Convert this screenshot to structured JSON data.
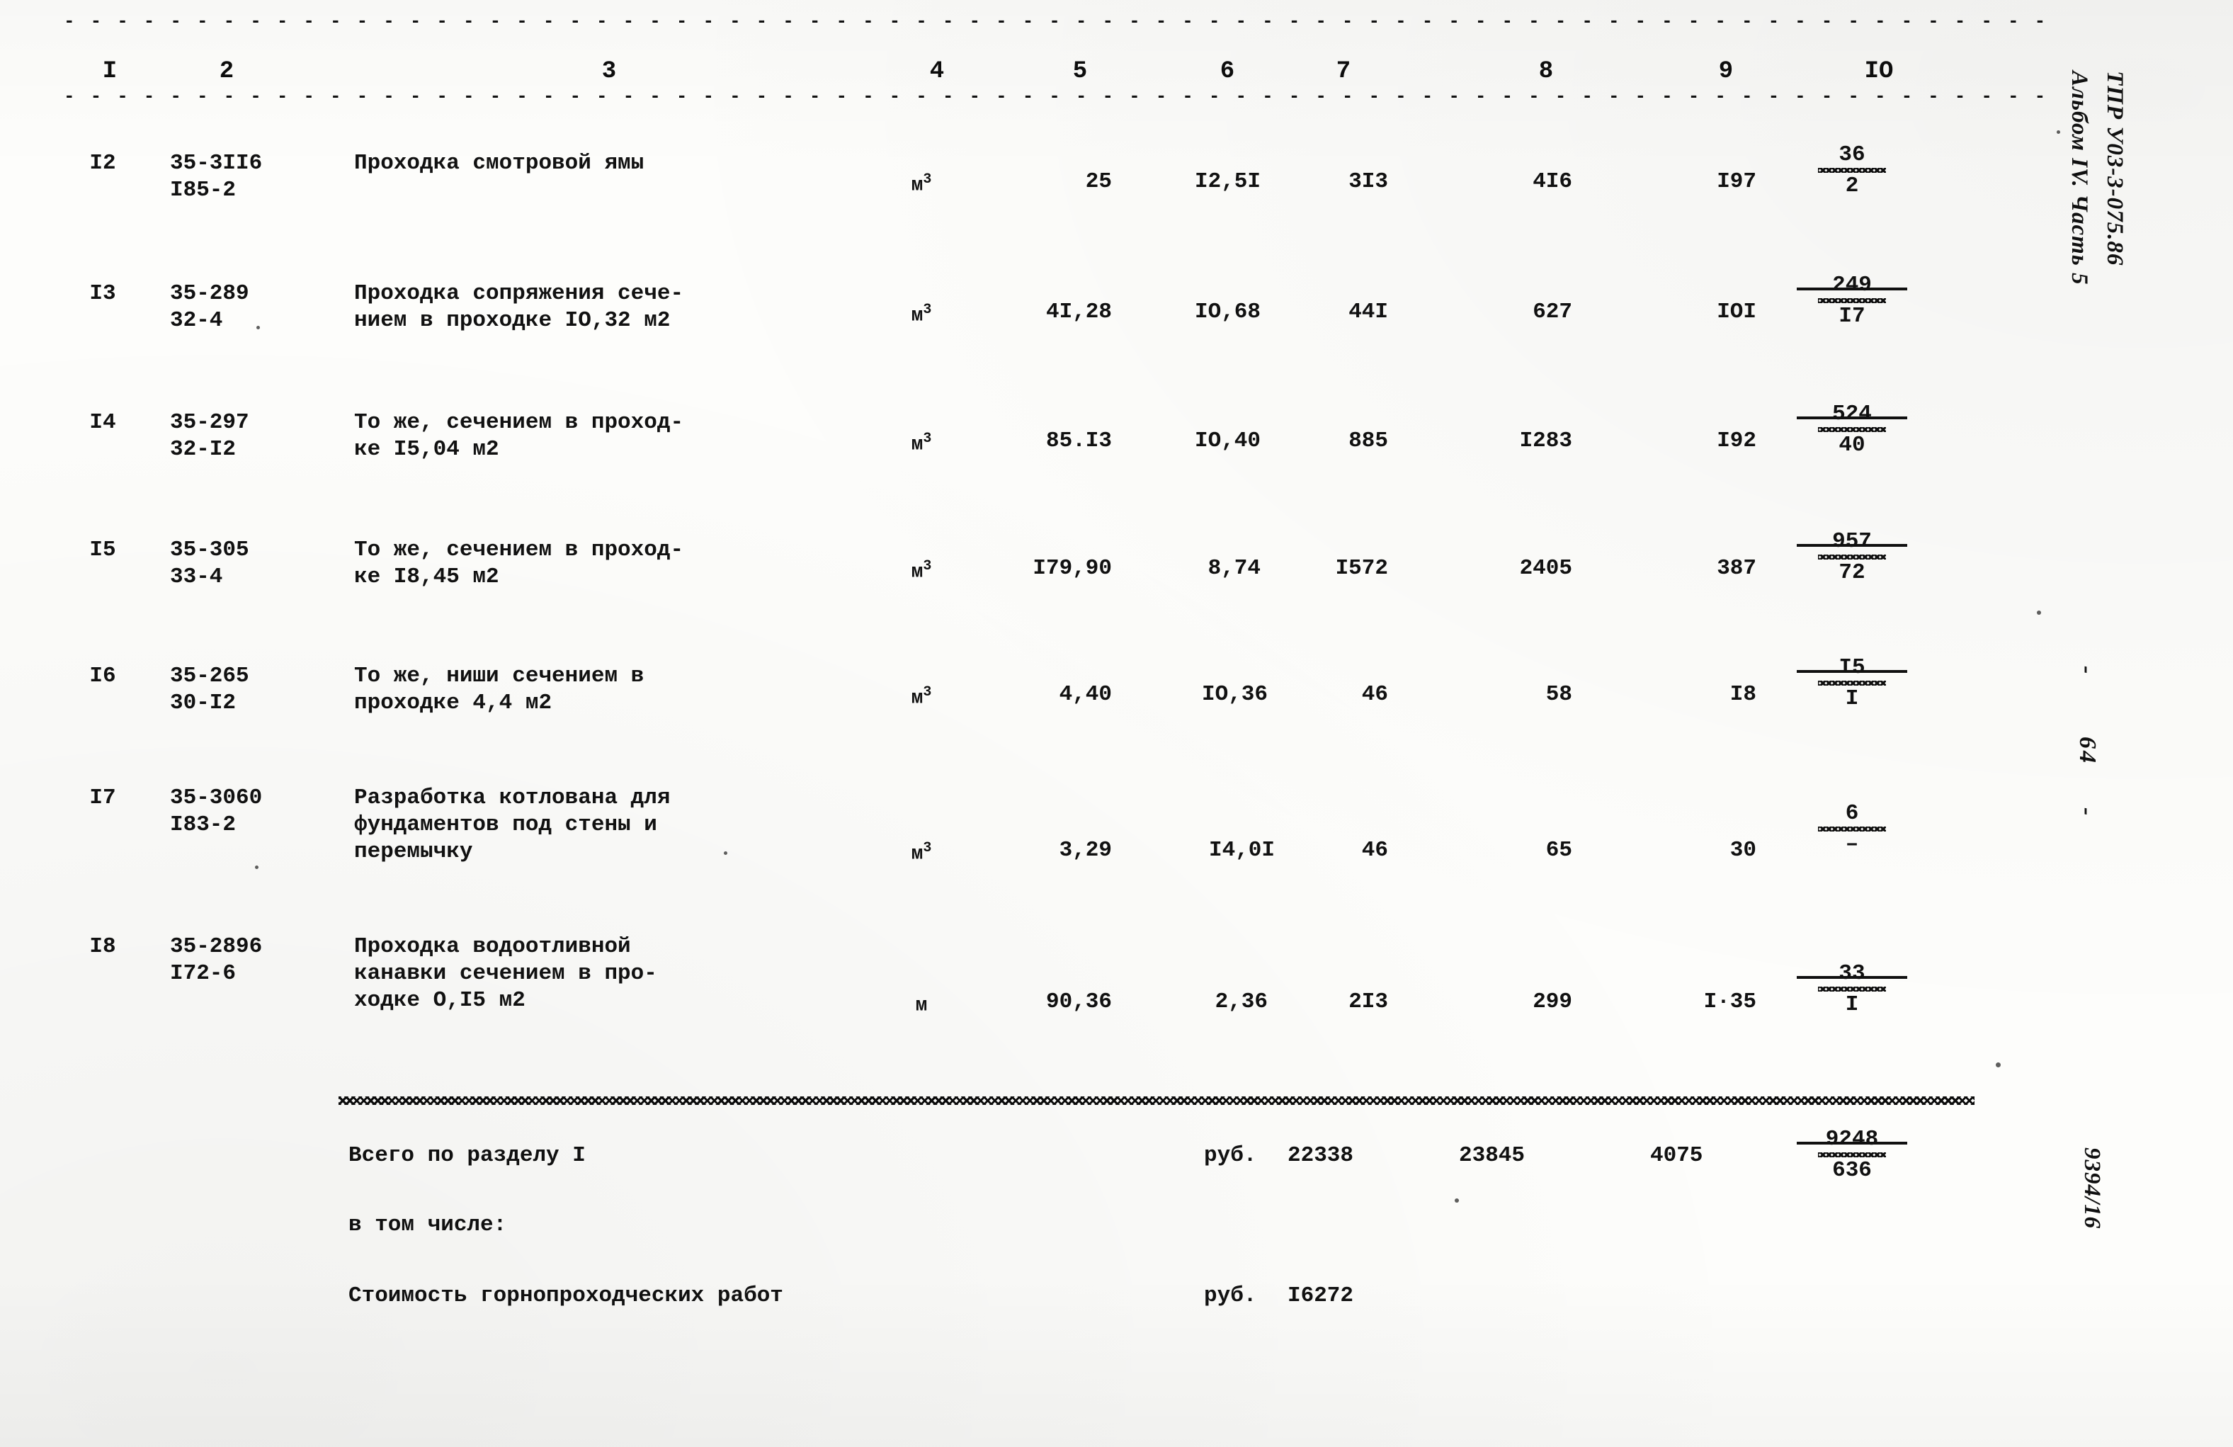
{
  "document": {
    "kind": "scanned-estimate-table",
    "language": "ru"
  },
  "table": {
    "column_headers": [
      "I",
      "2",
      "3",
      "4",
      "5",
      "6",
      "7",
      "8",
      "9",
      "IO"
    ],
    "rows": [
      {
        "no": "I2",
        "code_line1": "35-3II6",
        "code_line2": "I85-2",
        "description": "Проходка смотровой ямы",
        "unit": "м",
        "unit_sup": "3",
        "c5": "25",
        "c6": "I2,5I",
        "c7": "3I3",
        "c8": "4I6",
        "c9": "I97",
        "c10_top": "36",
        "c10_bottom": "2"
      },
      {
        "no": "I3",
        "code_line1": "35-289",
        "code_line2": "32-4",
        "description": "Проходка сопряжения сече-\nнием в проходке IO,32 м2",
        "unit": "м",
        "unit_sup": "3",
        "c5": "4I,28",
        "c6": "IO,68",
        "c7": "44I",
        "c8": "627",
        "c9": "IOI",
        "c10_top": "249",
        "c10_bottom": "I7"
      },
      {
        "no": "I4",
        "code_line1": "35-297",
        "code_line2": "32-I2",
        "description": "То же, сечением в проход-\nке I5,04 м2",
        "unit": "м",
        "unit_sup": "3",
        "c5": "85.I3",
        "c6": "IO,40",
        "c7": "885",
        "c8": "I283",
        "c9": "I92",
        "c10_top": "524",
        "c10_bottom": "40"
      },
      {
        "no": "I5",
        "code_line1": "35-305",
        "code_line2": "33-4",
        "description": "То же, сечением в проход-\nке I8,45 м2",
        "unit": "м",
        "unit_sup": "3",
        "c5": "I79,90",
        "c6": "8,74",
        "c7": "I572",
        "c8": "2405",
        "c9": "387",
        "c10_top": "957",
        "c10_bottom": "72"
      },
      {
        "no": "I6",
        "code_line1": "35-265",
        "code_line2": "30-I2",
        "description": "То же, ниши сечением в\nпроходке 4,4 м2",
        "unit": "м",
        "unit_sup": "3",
        "c5": "4,40",
        "c6": "IO,36",
        "c7": "46",
        "c8": "58",
        "c9": "I8",
        "c10_top": "I5",
        "c10_bottom": "I"
      },
      {
        "no": "I7",
        "code_line1": "35-3060",
        "code_line2": "I83-2",
        "description": "Разработка котлована для\nфундаментов под стены и\nперемычку",
        "unit": "м",
        "unit_sup": "3",
        "c5": "3,29",
        "c6": "I4,0I",
        "c7": "46",
        "c8": "65",
        "c9": "30",
        "c10_top": "6",
        "c10_bottom": "–"
      },
      {
        "no": "I8",
        "code_line1": "35-2896",
        "code_line2": "I72-6",
        "description": "Проходка водоотливной\nканавки сечением в про-\nходке О,I5 м2",
        "unit": "м",
        "unit_sup": "",
        "c5": "90,36",
        "c6": "2,36",
        "c7": "2I3",
        "c8": "299",
        "c9": "I·35",
        "c10_top": "33",
        "c10_bottom": "I"
      }
    ]
  },
  "totals": {
    "section_label": "Всего по разделу I",
    "currency": "руб.",
    "c7": "22338",
    "c8": "23845",
    "c9": "4075",
    "c10_top": "9248",
    "c10_bottom": "636",
    "including_label": "в том числе:",
    "mining_label": "Стоимость горнопроходческих работ",
    "mining_currency": "руб.",
    "mining_value": "I6272"
  },
  "margin": {
    "stamp_line1": "ТПР У03-3-075.86",
    "stamp_line2": "Альбом IV. Часть 5",
    "page_number": "64",
    "page_dash_left": "-",
    "page_dash_right": "-",
    "archive_code": "9394/16"
  }
}
